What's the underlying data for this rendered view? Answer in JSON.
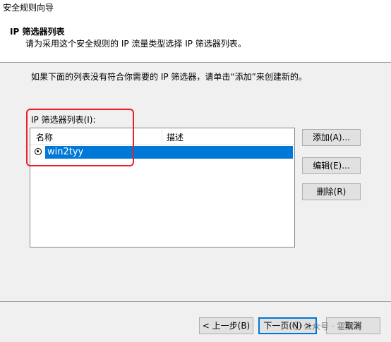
{
  "window": {
    "title": "安全规则向导"
  },
  "header": {
    "title": "IP 筛选器列表",
    "description": "请为采用这个安全规则的 IP 流量类型选择 IP 筛选器列表。"
  },
  "body": {
    "instruction": "如果下面的列表没有符合你需要的 IP 筛选器，请单击“添加”来创建新的。",
    "list_label": "IP 筛选器列表(I):",
    "columns": [
      "名称",
      "描述"
    ],
    "rows": [
      {
        "name": "win2tyy",
        "description": "",
        "selected": true
      }
    ]
  },
  "side_buttons": {
    "add": "添加(A)...",
    "edit": "编辑(E)...",
    "delete": "删除(R)"
  },
  "footer": {
    "back": "< 上一步(B)",
    "next": "下一页(N) >",
    "cancel": "取消"
  },
  "watermark": "公众号 · 霍雨哥",
  "colors": {
    "selection": "#0078d7",
    "highlight_box": "#e8212a"
  }
}
